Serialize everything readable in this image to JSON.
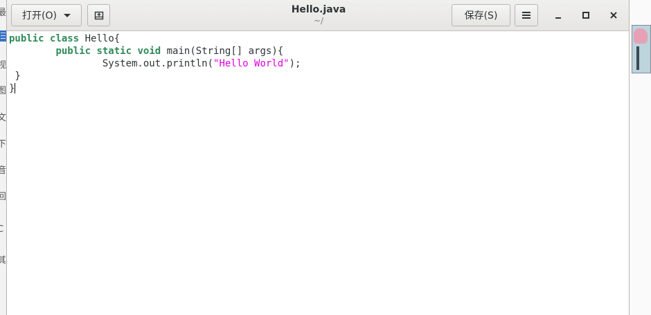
{
  "background": {
    "left_chars": [
      "最",
      "视",
      "图",
      "文",
      "下",
      "音",
      "回",
      "C",
      "其"
    ]
  },
  "headerbar": {
    "open_label": "打开(O)",
    "title": "Hello.java",
    "subtitle": "~/",
    "save_label": "保存(S)"
  },
  "editor": {
    "lines": [
      {
        "tokens": [
          {
            "text": "public",
            "kw": true
          },
          {
            "text": " "
          },
          {
            "text": "class",
            "kw": true
          },
          {
            "text": " Hello{"
          }
        ]
      },
      {
        "tokens": [
          {
            "text": "        "
          },
          {
            "text": "public",
            "kw": true
          },
          {
            "text": " "
          },
          {
            "text": "static",
            "kw": true
          },
          {
            "text": " "
          },
          {
            "text": "void",
            "kw": true
          },
          {
            "text": " main(String[] args){"
          }
        ]
      },
      {
        "tokens": [
          {
            "text": "                System.out.println("
          },
          {
            "text": "\"Hello World\"",
            "str": true
          },
          {
            "text": ");"
          }
        ]
      },
      {
        "tokens": [
          {
            "text": " }"
          }
        ]
      },
      {
        "tokens": [
          {
            "text": "}"
          }
        ],
        "caret": true
      }
    ]
  },
  "colors": {
    "keyword": "#2e8b57",
    "string": "#e000e0"
  }
}
